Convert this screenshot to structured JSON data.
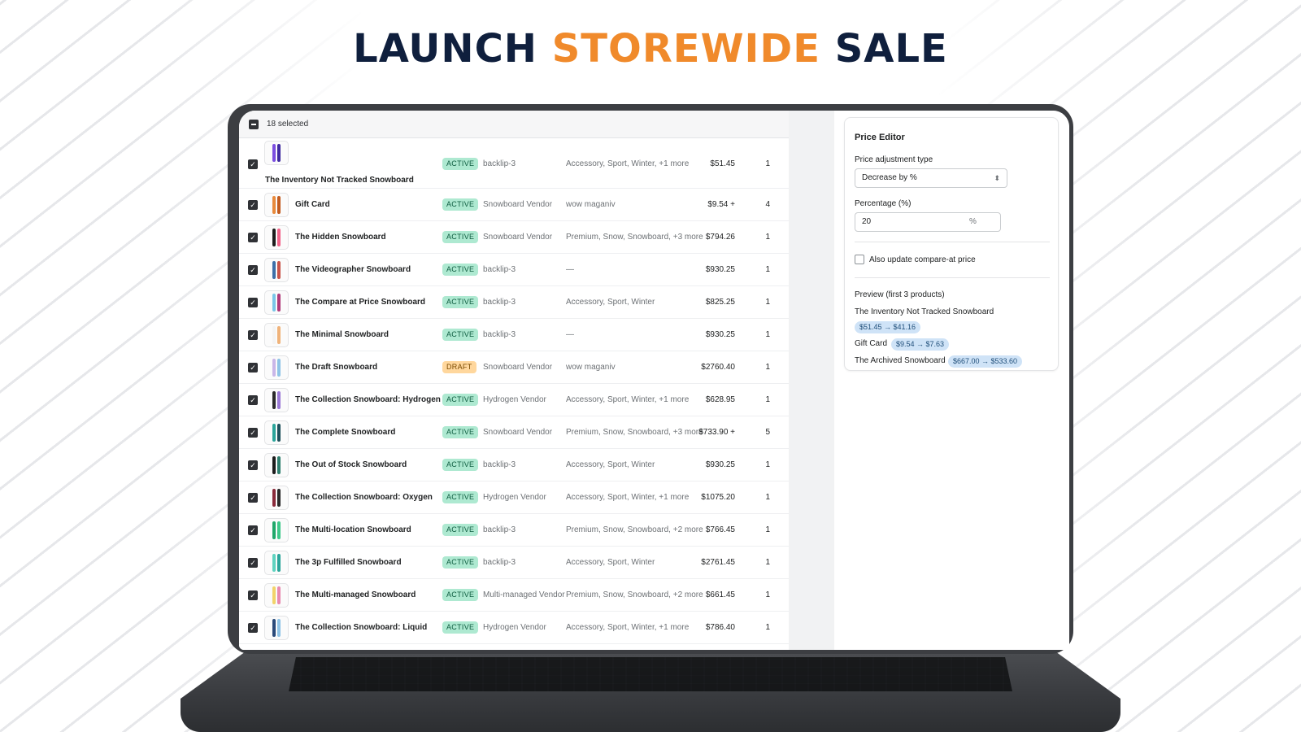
{
  "headline": {
    "word1": "LAUNCH",
    "word2": "STOREWIDE",
    "word3": "SALE"
  },
  "colors": {
    "accent_orange": "#f08a2b",
    "navy": "#0f1f3d",
    "active_badge": "#aee9d1",
    "draft_badge": "#ffd79d",
    "preview_pill": "#cfe3f7"
  },
  "selection": {
    "count_label": "18 selected"
  },
  "products": [
    {
      "name": "The Inventory Not Tracked Snowboard",
      "status": "ACTIVE",
      "vendor": "backlip-3",
      "tags": "Accessory, Sport, Winter, +1 more",
      "price": "$51.45",
      "qty": "1",
      "thumb": [
        "#7b4ee0",
        "#3f2aa0"
      ]
    },
    {
      "name": "Gift Card",
      "status": "ACTIVE",
      "vendor": "Snowboard Vendor",
      "tags": "wow maganiv",
      "price": "$9.54 +",
      "qty": "4",
      "thumb": [
        "#e88a3c",
        "#c25b1f"
      ]
    },
    {
      "name": "The Hidden Snowboard",
      "status": "ACTIVE",
      "vendor": "Snowboard Vendor",
      "tags": "Premium, Snow, Snowboard, +3 more",
      "price": "$794.26",
      "qty": "1",
      "thumb": [
        "#1c1c1c",
        "#f2648a"
      ]
    },
    {
      "name": "The Videographer Snowboard",
      "status": "ACTIVE",
      "vendor": "backlip-3",
      "tags": "—",
      "price": "$930.25",
      "qty": "1",
      "thumb": [
        "#3d6fa8",
        "#c9544a"
      ]
    },
    {
      "name": "The Compare at Price Snowboard",
      "status": "ACTIVE",
      "vendor": "backlip-3",
      "tags": "Accessory, Sport, Winter",
      "price": "$825.25",
      "qty": "1",
      "thumb": [
        "#7ac6e8",
        "#b03a7a"
      ]
    },
    {
      "name": "The Minimal Snowboard",
      "status": "ACTIVE",
      "vendor": "backlip-3",
      "tags": "—",
      "price": "$930.25",
      "qty": "1",
      "thumb": [
        "#f4f4f4",
        "#f0b37a"
      ]
    },
    {
      "name": "The Draft Snowboard",
      "status": "DRAFT",
      "vendor": "Snowboard Vendor",
      "tags": "wow maganiv",
      "price": "$2760.40",
      "qty": "1",
      "thumb": [
        "#c9b6e8",
        "#8fc3e6"
      ]
    },
    {
      "name": "The Collection Snowboard: Hydrogen",
      "status": "ACTIVE",
      "vendor": "Hydrogen Vendor",
      "tags": "Accessory, Sport, Winter, +1 more",
      "price": "$628.95",
      "qty": "1",
      "thumb": [
        "#2a2a2a",
        "#9b7ad6"
      ]
    },
    {
      "name": "The Complete Snowboard",
      "status": "ACTIVE",
      "vendor": "Snowboard Vendor",
      "tags": "Premium, Snow, Snowboard, +3 more",
      "price": "$733.90 +",
      "qty": "5",
      "thumb": [
        "#2aa59a",
        "#1d4f5a"
      ]
    },
    {
      "name": "The Out of Stock Snowboard",
      "status": "ACTIVE",
      "vendor": "backlip-3",
      "tags": "Accessory, Sport, Winter",
      "price": "$930.25",
      "qty": "1",
      "thumb": [
        "#1c1c1c",
        "#2f7f6f"
      ]
    },
    {
      "name": "The Collection Snowboard: Oxygen",
      "status": "ACTIVE",
      "vendor": "Hydrogen Vendor",
      "tags": "Accessory, Sport, Winter, +1 more",
      "price": "$1075.20",
      "qty": "1",
      "thumb": [
        "#8a2a3a",
        "#2a2a2a"
      ]
    },
    {
      "name": "The Multi-location Snowboard",
      "status": "ACTIVE",
      "vendor": "backlip-3",
      "tags": "Premium, Snow, Snowboard, +2 more",
      "price": "$766.45",
      "qty": "1",
      "thumb": [
        "#1fa86a",
        "#3ec98a"
      ]
    },
    {
      "name": "The 3p Fulfilled Snowboard",
      "status": "ACTIVE",
      "vendor": "backlip-3",
      "tags": "Accessory, Sport, Winter",
      "price": "$2761.45",
      "qty": "1",
      "thumb": [
        "#5fd3c0",
        "#2aa59a"
      ]
    },
    {
      "name": "The Multi-managed Snowboard",
      "status": "ACTIVE",
      "vendor": "Multi-managed Vendor",
      "tags": "Premium, Snow, Snowboard, +2 more",
      "price": "$661.45",
      "qty": "1",
      "thumb": [
        "#f2d36a",
        "#e88ab0"
      ]
    },
    {
      "name": "The Collection Snowboard: Liquid",
      "status": "ACTIVE",
      "vendor": "Hydrogen Vendor",
      "tags": "Accessory, Sport, Winter, +1 more",
      "price": "$786.40",
      "qty": "1",
      "thumb": [
        "#2a4a7a",
        "#8fc3e6"
      ]
    }
  ],
  "editor": {
    "title": "Price Editor",
    "adjustment_label": "Price adjustment type",
    "adjustment_value": "Decrease by %",
    "percentage_label": "Percentage (%)",
    "percentage_value": "20",
    "percentage_suffix": "%",
    "compare_at_label": "Also update compare-at price",
    "compare_at_checked": false,
    "preview_title": "Preview (first 3 products)",
    "preview": [
      {
        "name": "The Inventory Not Tracked Snowboard",
        "change": "$51.45 → $41.16"
      },
      {
        "name": "Gift Card",
        "change": "$9.54 → $7.63"
      },
      {
        "name": "The Archived Snowboard",
        "change": "$667.00 → $533.60"
      }
    ]
  }
}
